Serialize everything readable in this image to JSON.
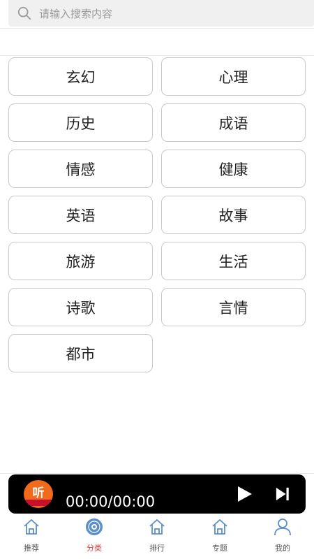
{
  "search": {
    "placeholder": "请输入搜索内容"
  },
  "categories": [
    "玄幻",
    "心理",
    "历史",
    "成语",
    "情感",
    "健康",
    "英语",
    "故事",
    "旅游",
    "生活",
    "诗歌",
    "言情",
    "都市"
  ],
  "player": {
    "logo_text": "听",
    "time": "00:00/00:00"
  },
  "tabs": [
    {
      "label": "推荐",
      "icon": "home-icon"
    },
    {
      "label": "分类",
      "icon": "disc-icon",
      "active": true
    },
    {
      "label": "排行",
      "icon": "home-icon"
    },
    {
      "label": "专题",
      "icon": "home-icon"
    },
    {
      "label": "我的",
      "icon": "user-icon"
    }
  ],
  "colors": {
    "accent": "#e53935",
    "player_bg": "#000000",
    "tab_icon": "#5b8fc7",
    "search_bg": "#f0f0f0"
  }
}
